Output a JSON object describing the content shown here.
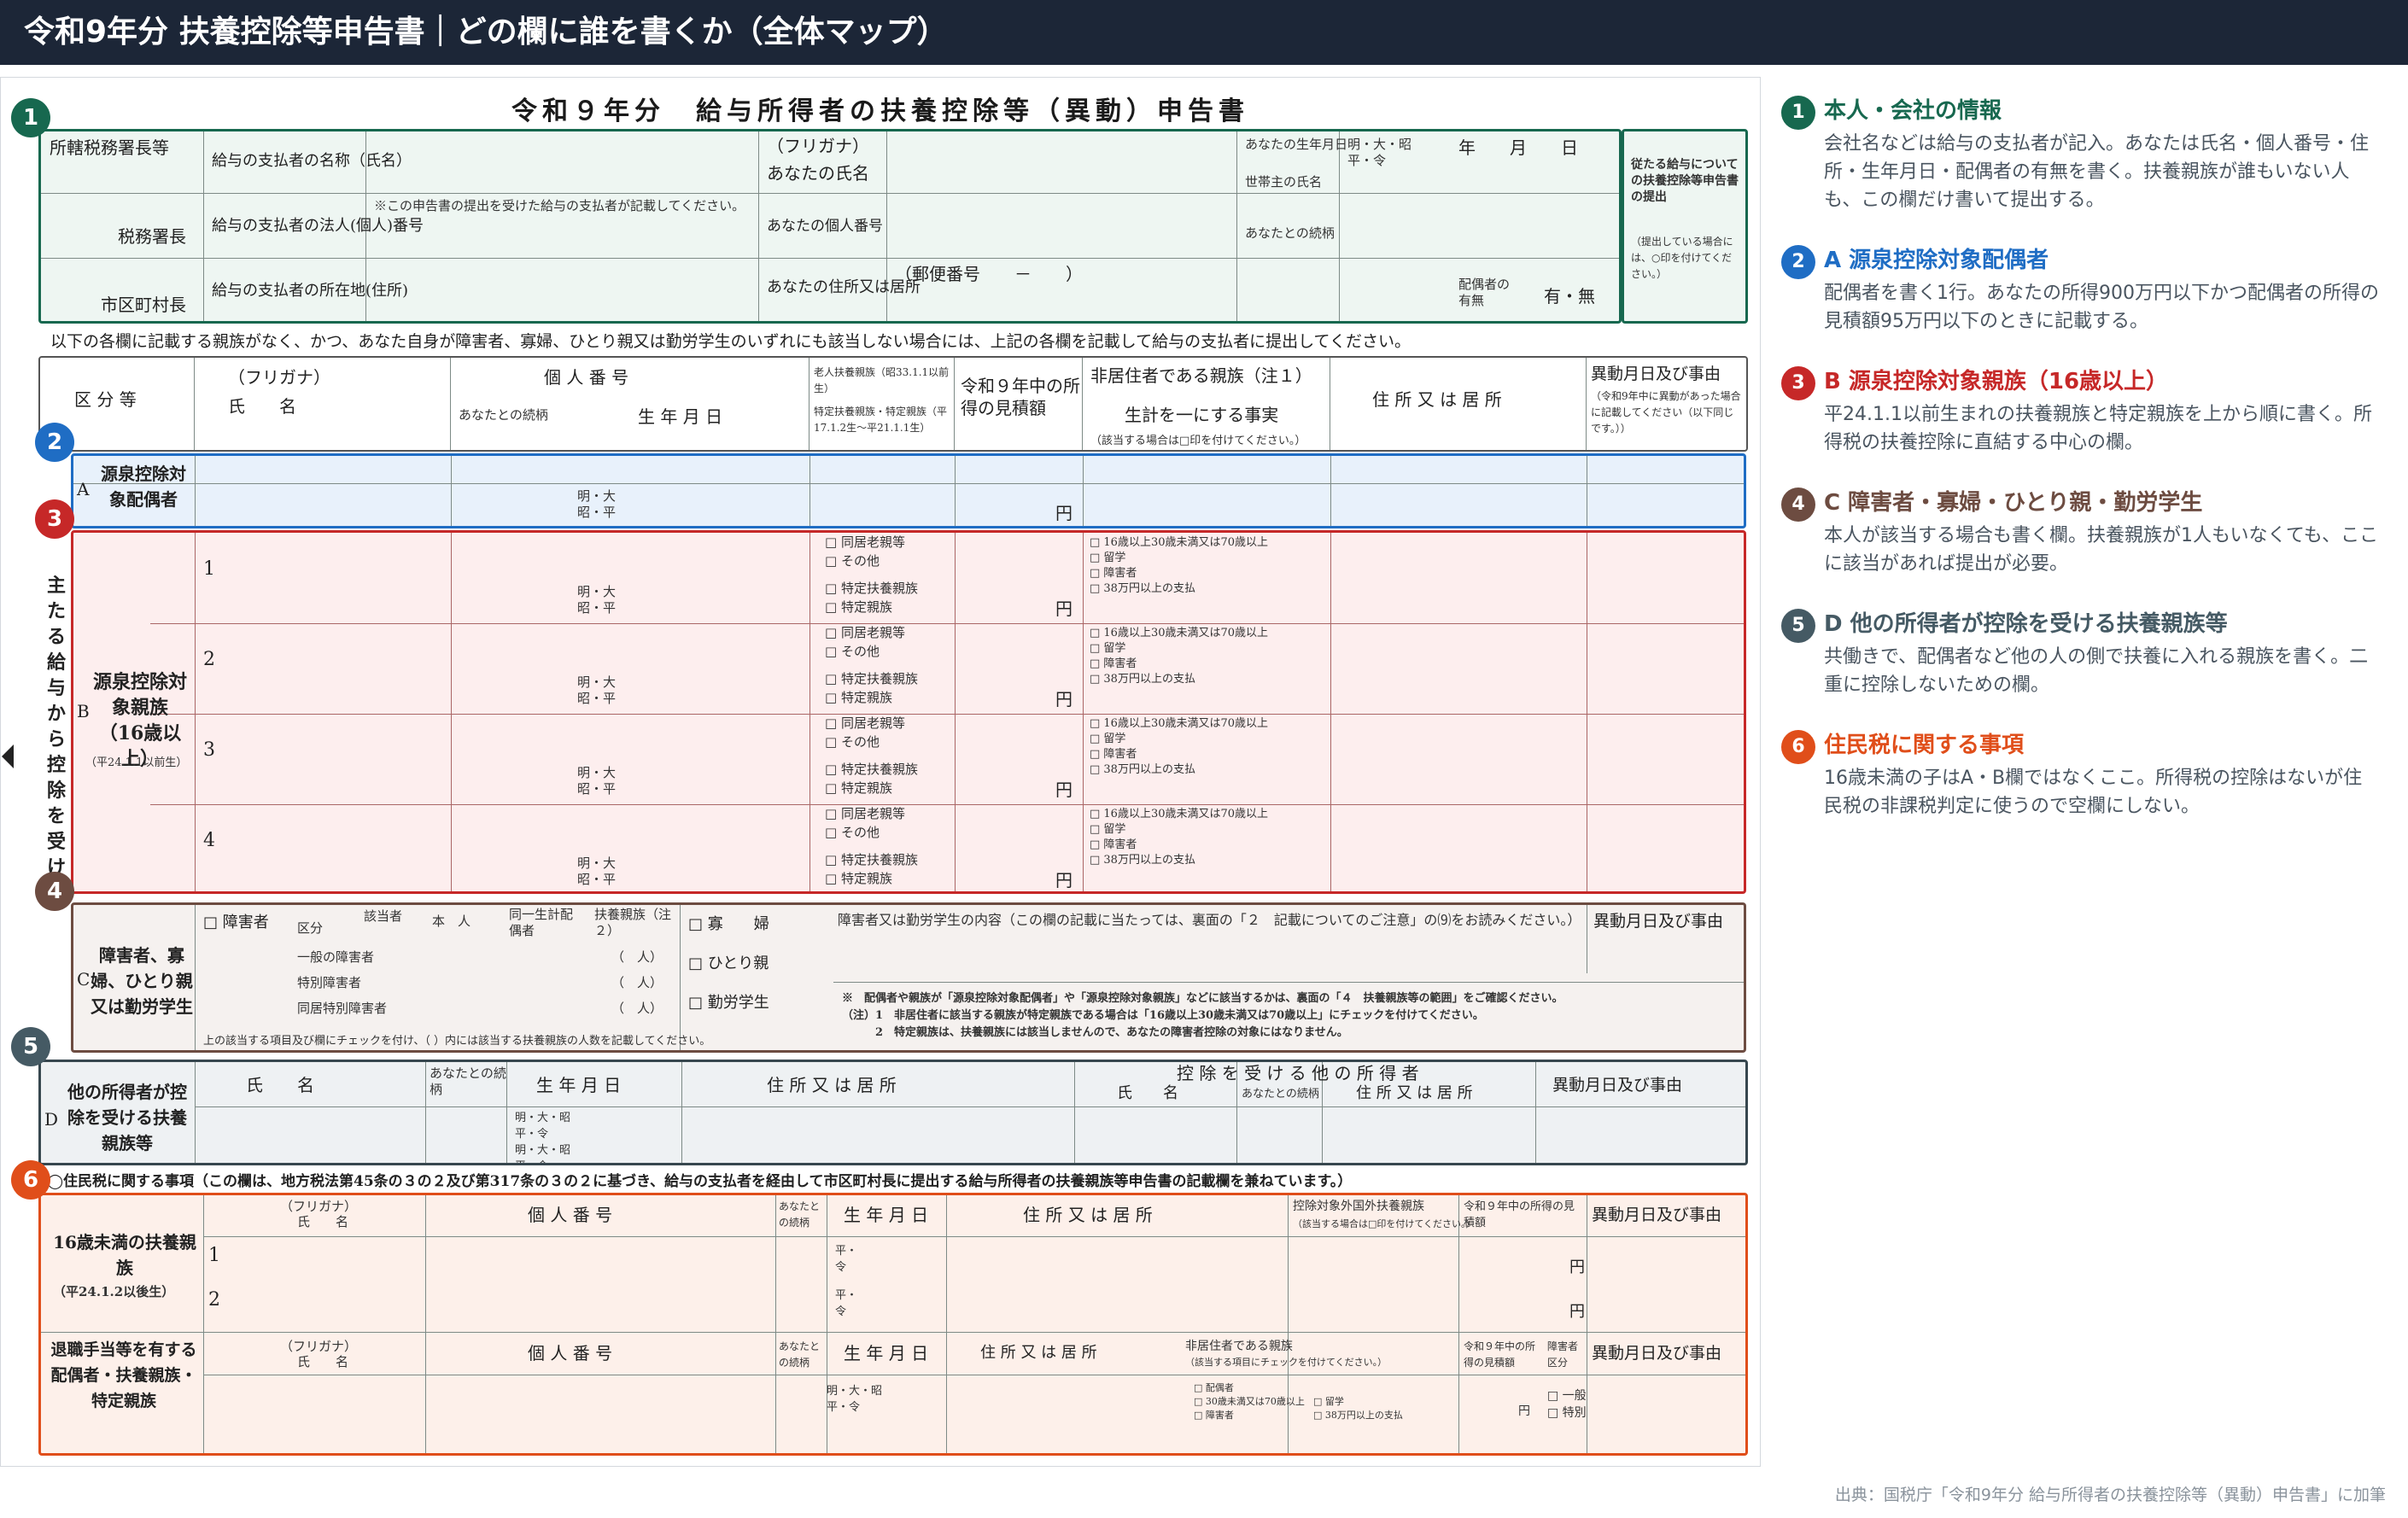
{
  "header": {
    "title": "令和9年分 扶養控除等申告書｜どの欄に誰を書くか（全体マップ）"
  },
  "form": {
    "title": "令和９年分　給与所得者の扶養控除等（異動）申告書",
    "note": "以下の各欄に記載する親族がなく、かつ、あなた自身が障害者、寡婦、ひとり親又は勤労学生のいずれにも該当しない場合には、上記の各欄を記載して給与の支払者に提出してください。",
    "side_text": "主たる給与から控除を受ける",
    "sec1": {
      "office": "所轄税務署長等",
      "zeimu": "税務署長",
      "shicho": "市区町村長",
      "payer_name": "給与の支払者の名称（氏名）",
      "payer_no": "給与の支払者の法人(個人)番号",
      "payer_no_note": "※この申告書の提出を受けた給与の支払者が記載してください。",
      "payer_addr": "給与の支払者の所在地(住所)",
      "furigana": "（フリガナ）",
      "your_name": "あなたの氏名",
      "your_no": "あなたの個人番号",
      "your_addr": "あなたの住所又は居所",
      "postal": "（郵便番号　　－　　）",
      "birth": "あなたの生年月日",
      "era": "明・大・昭 平・令",
      "ymd": "年　　月　　日",
      "head": "世帯主の氏名",
      "relation": "あなたとの続柄",
      "spouse": "配偶者の有無",
      "yesno": "有・無",
      "side_box": "従たる給与についての扶養控除等申告書の提出",
      "side_box_note": "（提出している場合には、○印を付けてください。）"
    },
    "cols": {
      "kubun": "区 分 等",
      "furigana": "（フリガナ）",
      "name": "氏　　名",
      "kojin": "個 人 番 号",
      "relation": "あなたとの続柄",
      "birth": "生 年 月 日",
      "rojin": "老人扶養親族（昭33.1.1以前生）",
      "tokutei": "特定扶養親族・特定親族（平17.1.2生～平21.1.1生）",
      "income": "令和９年中の所得の見積額",
      "hikyo": "非居住者である親族（注１）",
      "seikei": "生計を一にする事実",
      "hikyo_note": "（該当する場合は□印を付けてください。）",
      "addr": "住 所 又 は 居 所",
      "change": "異動月日及び事由",
      "change_note": "（令和9年中に異動があった場合に記載してください（以下同じです。））"
    },
    "secA": {
      "label": "源泉控除対象配偶者",
      "letter": "A",
      "era": "明・大 昭・平",
      "yen": "円"
    },
    "secB": {
      "label": "源泉控除対象親族（16歳以上）",
      "sub": "（平24.1.1以前生）",
      "letter": "B",
      "rows": [
        "1",
        "2",
        "3",
        "4"
      ],
      "chk1": "□ 同居老親等",
      "chk2": "□ その他",
      "chk3": "□ 特定扶養親族",
      "chk4": "□ 特定親族",
      "hikyo1": "□ 16歳以上30歳未満又は70歳以上",
      "hikyo2": "□ 留学",
      "hikyo3": "□ 障害者",
      "hikyo4": "□ 38万円以上の支払",
      "yen": "円",
      "era": "明・大 昭・平"
    },
    "secC": {
      "label": "障害者、寡婦、ひとり親又は勤労学生",
      "letter": "C",
      "shogai": "□ 障害者",
      "kubun": "区分",
      "gaito": "該当者",
      "honnin": "本　人",
      "haigu": "同一生計配偶者",
      "fuyo": "扶養親族（注２）",
      "ippan": "一般の障害者",
      "tokubetsu": "特別障害者",
      "dokyo": "同居特別障害者",
      "nin": "（　人）",
      "kafu": "□ 寡　　婦",
      "hitori": "□ ひとり親",
      "kinro": "□ 勤労学生",
      "naiyo": "障害者又は勤労学生の内容（この欄の記載に当たっては、裏面の「２　記載についてのご注意」の⑼をお読みください。）",
      "change": "異動月日及び事由",
      "note1": "※　配偶者や親族が「源泉控除対象配偶者」や「源泉控除対象親族」などに該当するかは、裏面の「４　扶養親族等の範囲」をご確認ください。",
      "note2": "（注）1　非居住者に該当する親族が特定親族である場合は「16歳以上30歳未満又は70歳以上」にチェックを付けてください。",
      "note3": "　　　2　特定親族は、扶養親族には該当しませんので、あなたの障害者控除の対象にはなりません。",
      "note4": "上の該当する項目及び欄にチェックを付け、（ ）内には該当する扶養親族の人数を記載してください。"
    },
    "secD": {
      "label": "他の所得者が控除を受ける扶養親族等",
      "letter": "D",
      "name": "氏　　名",
      "relation": "あなたとの続柄",
      "birth": "生 年 月 日",
      "addr": "住 所 又 は 居 所",
      "other": "控 除 を 受 け る 他 の 所 得 者",
      "o_name": "氏　　名",
      "o_rel": "あなたとの続柄",
      "o_addr": "住 所 又 は 居 所",
      "change": "異動月日及び事由",
      "era1": "明・大・昭 平・令",
      "era2": "明・大・昭 平・令"
    },
    "sec6": {
      "heading": "◯住民税に関する事項（この欄は、地方税法第45条の３の２及び第317条の３の２に基づき、給与の支払者を経由して市区町村長に提出する給与所得者の扶養親族等申告書の記載欄を兼ねています。）",
      "u16": "16歳未満の扶養親族",
      "u16_sub": "（平24.1.2以後生）",
      "furigana": "（フリガナ）",
      "name": "氏　　名",
      "kojin": "個 人 番 号",
      "relation": "あなたとの続柄",
      "birth": "生 年 月 日",
      "addr": "住 所 又 は 居 所",
      "kokugai": "控除対象外国外扶養親族",
      "kokugai_note": "（該当する場合は□印を付けてください。）",
      "income": "令和９年中の所得の見積額",
      "change": "異動月日及び事由",
      "rows": [
        "1",
        "2"
      ],
      "yen": "円",
      "era": "平・令",
      "taishoku": "退職手当等を有する配偶者・扶養親族・特定親族",
      "hikyo": "非居住者である親族",
      "hikyo_note": "（該当する項目にチェックを付けてください。）",
      "kubun": "障害者区分",
      "ippan": "□ 一般",
      "tokubetsu": "□ 特別",
      "t_chk1": "□ 配偶者",
      "t_chk2": "□ 30歳未満又は70歳以上",
      "t_chk3": "□ 障害者",
      "t_chk4": "□ 留学",
      "t_chk5": "□ 38万円以上の支払",
      "era2": "明・大・昭 平・令"
    }
  },
  "badges": [
    "1",
    "2",
    "3",
    "4",
    "5",
    "6"
  ],
  "legend": [
    {
      "num": "1",
      "title": "本人・会社の情報",
      "desc": "会社名などは給与の支払者が記入。あなたは氏名・個人番号・住所・生年月日・配偶者の有無を書く。扶養親族が誰もいない人も、この欄だけ書いて提出する。"
    },
    {
      "num": "2",
      "title": "A 源泉控除対象配偶者",
      "desc": "配偶者を書く1行。あなたの所得900万円以下かつ配偶者の所得の見積額95万円以下のときに記載する。"
    },
    {
      "num": "3",
      "title": "B 源泉控除対象親族（16歳以上）",
      "desc": "平24.1.1以前生まれの扶養親族と特定親族を上から順に書く。所得税の扶養控除に直結する中心の欄。"
    },
    {
      "num": "4",
      "title": "C 障害者・寡婦・ひとり親・勤労学生",
      "desc": "本人が該当する場合も書く欄。扶養親族が1人もいなくても、ここに該当があれば提出が必要。"
    },
    {
      "num": "5",
      "title": "D 他の所得者が控除を受ける扶養親族等",
      "desc": "共働きで、配偶者など他の人の側で扶養に入れる親族を書く。二重に控除しないための欄。"
    },
    {
      "num": "6",
      "title": "住民税に関する事項",
      "desc": "16歳未満の子はA・B欄ではなくここ。所得税の控除はないが住民税の非課税判定に使うので空欄にしない。"
    }
  ],
  "colors": {
    "c1": "#17684f",
    "c2": "#1f6dc4",
    "c3": "#c62828",
    "c4": "#6d4c41",
    "c5": "#455a64",
    "c6": "#e04e1a"
  },
  "source": "出典：国税庁「令和9年分 給与所得者の扶養控除等（異動）申告書」に加筆"
}
